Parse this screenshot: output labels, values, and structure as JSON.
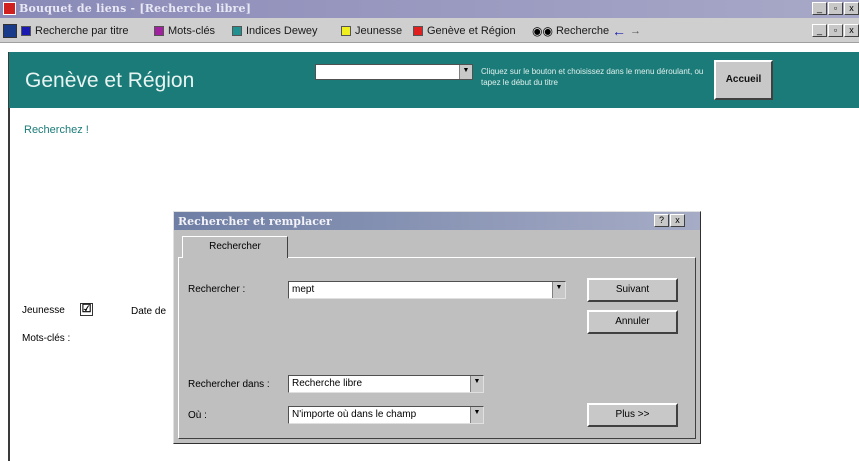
{
  "window": {
    "title": "Bouquet de liens - [Recherche libre]",
    "controls": [
      "_",
      "▫",
      "x"
    ]
  },
  "toolbar": {
    "items": [
      {
        "label": "Recherche par titre",
        "color": "#1a1ab0"
      },
      {
        "label": "Mots-clés",
        "color": "#a020a0"
      },
      {
        "label": "Indices Dewey",
        "color": "#209090"
      },
      {
        "label": "Jeunesse",
        "color": "#f0f020"
      },
      {
        "label": "Genève et Région",
        "color": "#e02020"
      }
    ],
    "search_label": "Recherche",
    "back_symbol": "←",
    "forward_symbol": "→"
  },
  "header": {
    "title": "Genève et Région",
    "combo_value": "",
    "hint": "Cliquez sur le bouton et choisissez dans le menu déroulant, ou tapez le début du titre",
    "accueil_label": "Accueil"
  },
  "main": {
    "recherchez": "Recherchez !",
    "jeunesse_label": "Jeunesse",
    "jeunesse_checked": "☑",
    "date_label": "Date de",
    "motscles_label": "Mots-clés :"
  },
  "dialog": {
    "title": "Rechercher et remplacer",
    "help": "?",
    "close": "x",
    "tab": "Rechercher",
    "search_label": "Rechercher :",
    "search_value": "mept",
    "suivant": "Suivant",
    "annuler": "Annuler",
    "rechercher_dans_label": "Rechercher dans :",
    "rechercher_dans_value": "Recherche libre",
    "ou_label": "Où :",
    "ou_value": "N'importe où dans le champ",
    "plus": "Plus >>"
  }
}
